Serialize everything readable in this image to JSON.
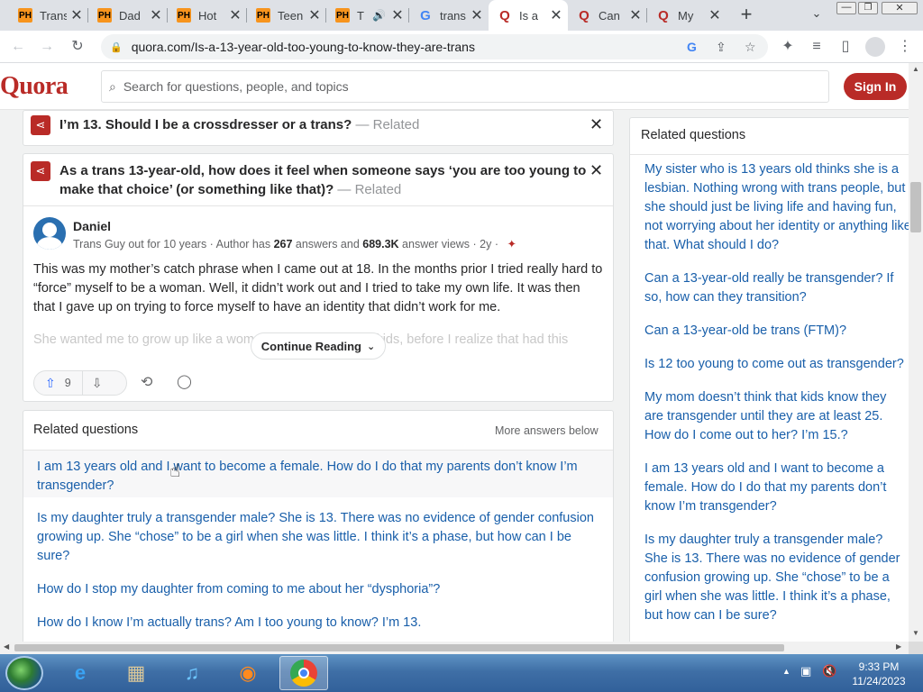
{
  "browser": {
    "tabs": [
      {
        "title": "Trans",
        "favicon": "PH",
        "type": "ph"
      },
      {
        "title": "Dad",
        "favicon": "PH",
        "type": "ph"
      },
      {
        "title": "Hot",
        "favicon": "PH",
        "type": "ph"
      },
      {
        "title": "Teen",
        "favicon": "PH",
        "type": "ph"
      },
      {
        "title": "T",
        "favicon": "PH",
        "type": "ph"
      },
      {
        "title": "trans",
        "favicon": "G",
        "type": "g"
      },
      {
        "title": "Is a",
        "favicon": "Q",
        "type": "q",
        "active": true
      },
      {
        "title": "Can",
        "favicon": "Q",
        "type": "q"
      },
      {
        "title": "My",
        "favicon": "Q",
        "type": "q"
      }
    ],
    "url": "quora.com/Is-a-13-year-old-too-young-to-know-they-are-trans"
  },
  "quora": {
    "logo": "Quora",
    "search_placeholder": "Search for questions, people, and topics",
    "signin_label": "Sign In"
  },
  "related_cards": [
    {
      "title": "I’m 13. Should I be a crossdresser or a trans?",
      "suffix": "— Related"
    },
    {
      "title_line1": "As a trans 13-year-old, how does it feel when someone says ‘you are too young to",
      "title_line2": "make that choice’ (or something like that)?",
      "suffix": "— Related"
    }
  ],
  "answer": {
    "author": "Daniel",
    "credential_prefix": "Trans Guy out for 10 years · Author has ",
    "answers_count": "267",
    "credential_mid": " answers and ",
    "views": "689.3K",
    "credential_suffix": " answer views · 2y ·",
    "paragraph1": "This was my mother’s catch phrase when I came out at 18. In the months prior I tried really hard to “force” myself to be a woman. Well, it didn’t work out and I tried to take my own life. It was then that I gave up on trying to force myself to have an identity that didn’t work for me.",
    "paragraph2": "She wanted me to grow up like a woman, pop out a couple kids, before I realize that had this",
    "continue_label": "Continue Reading",
    "upvotes": "9"
  },
  "related_questions_main": {
    "heading": "Related questions",
    "more_label": "More answers below",
    "items": [
      "I am 13 years old and I want to become a female. How do I do that my parents don’t know I’m transgender?",
      "Is my daughter truly a transgender male? She is 13. There was no evidence of gender confusion growing up. She “chose” to be a girl when she was little. I think it’s a phase, but how can I be sure?",
      "How do I stop my daughter from coming to me about her “dysphoria”?",
      "How do I know I’m actually trans? Am I too young to know? I’m 13."
    ]
  },
  "related_questions_side": {
    "heading": "Related questions",
    "items": [
      "My sister who is 13 years old thinks she is a lesbian. Nothing wrong with trans people, but she should just be living life and having fun, not worrying about her identity or anything like that. What should I do?",
      "Can a 13-year-old really be transgender? If so, how can they transition?",
      "Can a 13-year-old be trans (FTM)?",
      "Is 12 too young to come out as transgender?",
      "My mom doesn’t think that kids know they are transgender until they are at least 25. How do I come out to her? I’m 15.?",
      "I am 13 years old and I want to become a female. How do I do that my parents don’t know I’m transgender?",
      "Is my daughter truly a transgender male? She is 13. There was no evidence of gender confusion growing up. She “chose” to be a girl when she was little. I think it’s a phase, but how can I be sure?"
    ]
  },
  "taskbar": {
    "time": "9:33 PM",
    "date": "11/24/2023"
  }
}
